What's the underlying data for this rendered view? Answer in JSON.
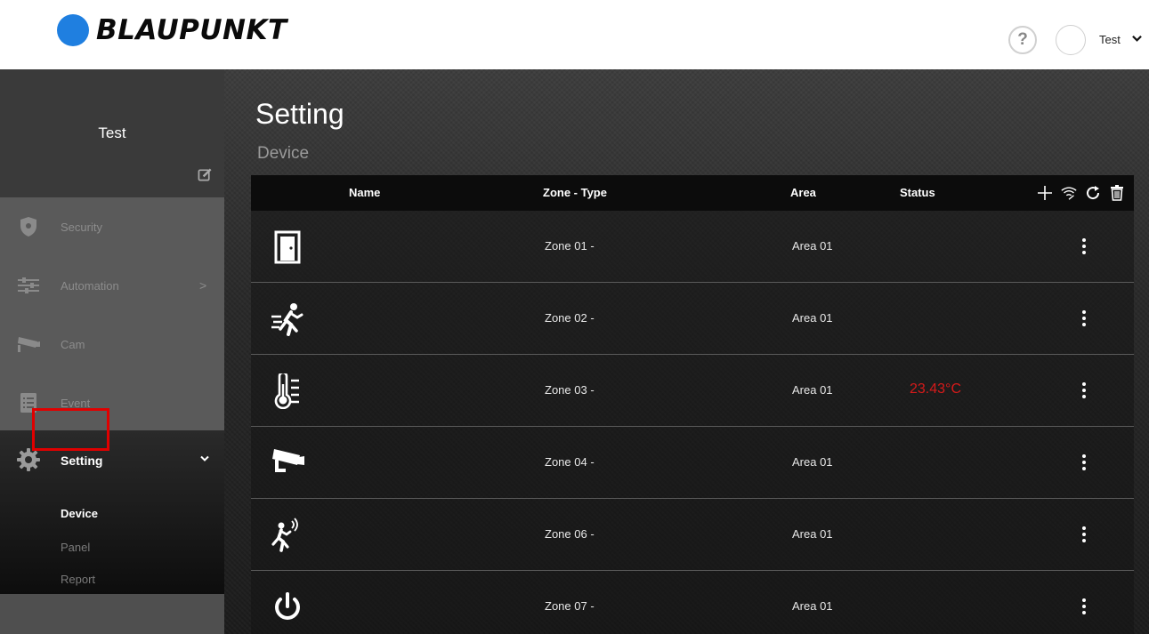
{
  "header": {
    "brand": "BLAUPUNKT",
    "help_symbol": "?",
    "user_name": "Test",
    "colors": {
      "brand_dot": "#1f7fe0"
    }
  },
  "sidebar": {
    "user_name": "Test",
    "items": [
      {
        "label": "Security",
        "icon": "shield-icon"
      },
      {
        "label": "Automation",
        "icon": "sliders-icon",
        "arrow": ">"
      },
      {
        "label": "Cam",
        "icon": "camera-icon"
      },
      {
        "label": "Event",
        "icon": "list-icon"
      }
    ],
    "setting": {
      "label": "Setting",
      "icon": "gear-icon",
      "subitems": [
        {
          "label": "Device",
          "active": true
        },
        {
          "label": "Panel",
          "active": false
        },
        {
          "label": "Report",
          "active": false
        }
      ]
    }
  },
  "main": {
    "title": "Setting",
    "subtitle": "Device",
    "table": {
      "headers": {
        "name": "Name",
        "zone_type": "Zone - Type",
        "area": "Area",
        "status": "Status"
      },
      "actions": [
        "add-icon",
        "wifi-scan-icon",
        "refresh-icon",
        "delete-icon"
      ],
      "rows": [
        {
          "icon": "door-sensor-icon",
          "zone": "Zone 01 -",
          "area": "Area 01",
          "status": ""
        },
        {
          "icon": "motion-detector-icon",
          "zone": "Zone 02 -",
          "area": "Area 01",
          "status": ""
        },
        {
          "icon": "temperature-sensor-icon",
          "zone": "Zone 03 -",
          "area": "Area 01",
          "status": "23.43°C"
        },
        {
          "icon": "camera-icon",
          "zone": "Zone 04 -",
          "area": "Area 01",
          "status": ""
        },
        {
          "icon": "motion-wave-icon",
          "zone": "Zone 06 -",
          "area": "Area 01",
          "status": ""
        },
        {
          "icon": "power-icon",
          "zone": "Zone 07 -",
          "area": "Area 01",
          "status": ""
        }
      ]
    },
    "colors": {
      "status_alert": "#d61a1a"
    }
  }
}
